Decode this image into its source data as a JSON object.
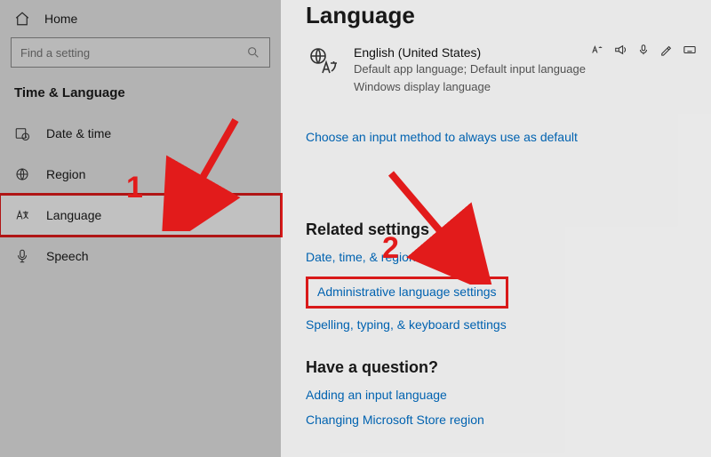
{
  "sidebar": {
    "home_label": "Home",
    "search_placeholder": "Find a setting",
    "section_title": "Time & Language",
    "items": [
      {
        "label": "Date & time"
      },
      {
        "label": "Region"
      },
      {
        "label": "Language"
      },
      {
        "label": "Speech"
      }
    ]
  },
  "main": {
    "title": "Language",
    "current_language": {
      "name": "English (United States)",
      "line1": "Default app language; Default input language",
      "line2": "Windows display language"
    },
    "input_method_link": "Choose an input method to always use as default",
    "related_heading": "Related settings",
    "related_links": {
      "datetime": "Date, time, & regional formatting",
      "admin": "Administrative language settings",
      "spelling": "Spelling, typing, & keyboard settings"
    },
    "question_heading": "Have a question?",
    "question_links": {
      "add_lang": "Adding an input language",
      "store_region": "Changing Microsoft Store region"
    }
  },
  "annotations": {
    "step1": "1",
    "step2": "2"
  }
}
